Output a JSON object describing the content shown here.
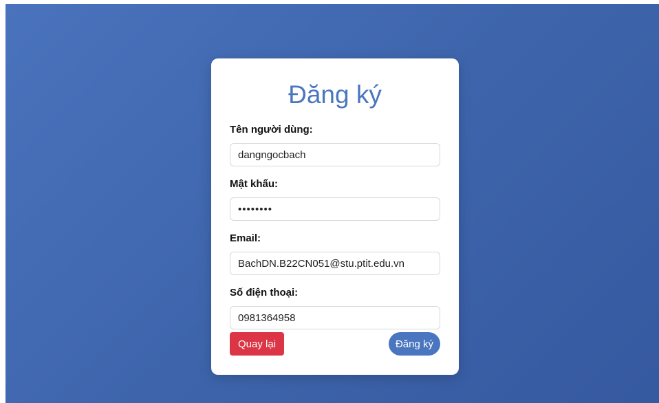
{
  "form": {
    "title": "Đăng ký",
    "fields": [
      {
        "label": "Tên người dùng:",
        "value": "dangngocbach",
        "type": "text"
      },
      {
        "label": "Mật khẩu:",
        "value": "••••••••",
        "type": "password"
      },
      {
        "label": "Email:",
        "value": "BachDN.B22CN051@stu.ptit.edu.vn",
        "type": "email"
      },
      {
        "label": "Số điện thoại:",
        "value": "0981364958",
        "type": "tel"
      }
    ],
    "back_label": "Quay lại",
    "submit_label": "Đăng ký"
  },
  "colors": {
    "background": "#4a73bd",
    "title": "#4a76c0",
    "back_button": "#dc3545",
    "submit_button": "#4a76c0"
  }
}
